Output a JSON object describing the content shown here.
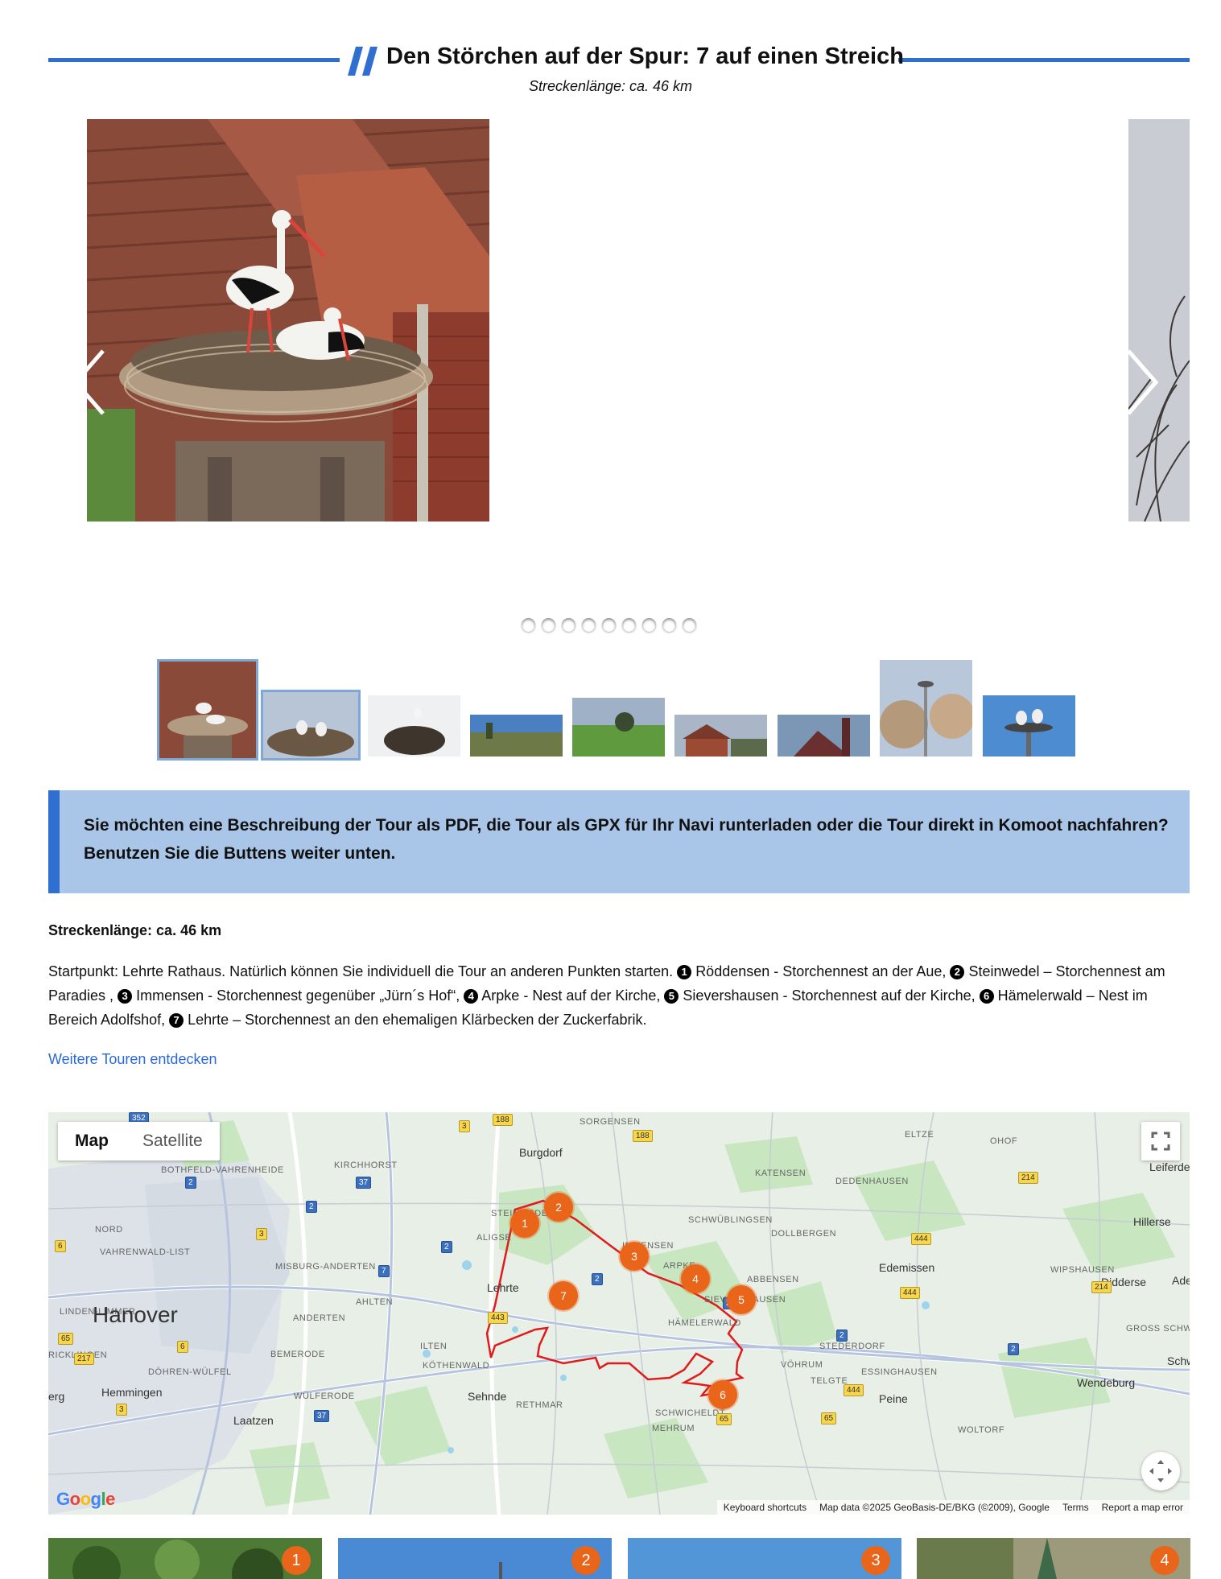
{
  "header": {
    "title": "Den Störchen auf der Spur: 7 auf einen Streich",
    "subtitle": "Streckenlänge: ca. 46 km",
    "accent_color": "#2f6fd0"
  },
  "carousel": {
    "prev_icon": "chevron-left-icon",
    "next_icon": "chevron-right-icon",
    "dot_count": 9,
    "active_index": 0
  },
  "thumbnails": {
    "count": 9,
    "selected_index": 0
  },
  "info_box": {
    "text": "Sie möchten eine Beschreibung der Tour als PDF, die Tour als GPX für Ihr Navi runterladen oder die Tour direkt in Komoot nachfahren? Benutzen Sie die Buttens weiter unten.",
    "background": "#a9c6e8"
  },
  "route": {
    "length": "Streckenlänge: ca. 46 km",
    "intro": "Startpunkt: Lehrte Rathaus. Natürlich können Sie individuell die Tour an anderen Punkten starten.",
    "stops": [
      {
        "n": "1",
        "text": "Röddensen - Storchennest an der Aue,"
      },
      {
        "n": "2",
        "text": "Steinwedel – Storchennest am Paradies ,"
      },
      {
        "n": "3",
        "text": "Immensen - Storchennest gegenüber „Jürn´s Hof“,"
      },
      {
        "n": "4",
        "text": "Arpke - Nest auf der Kirche,"
      },
      {
        "n": "5",
        "text": "Sievershausen - Storchennest auf der Kirche,"
      },
      {
        "n": "6",
        "text": "Hämelerwald – Nest im Bereich Adolfshof,"
      },
      {
        "n": "7",
        "text": "Lehrte – Storchennest an den ehemaligen Klärbecken der Zuckerfabrik."
      }
    ],
    "more_link": "Weitere Touren entdecken"
  },
  "map": {
    "tab_map": "Map",
    "tab_satellite": "Satellite",
    "active_tab": "Map",
    "fullscreen_icon": "fullscreen-icon",
    "camera_icon": "camera-control-icon",
    "logo": "Google",
    "footer": {
      "shortcuts": "Keyboard shortcuts",
      "data": "Map data ©2025 GeoBasis-DE/BKG (©2009), Google",
      "terms": "Terms",
      "report": "Report a map error"
    },
    "big_label": "Hanover",
    "labels": [
      "SORGENSEN",
      "Burgdorf",
      "ELTZE",
      "OHOF",
      "Leiferde",
      "BOTHFELD-VAHRENHEIDE",
      "KIRCHHORST",
      "KATENSEN",
      "DEDENHAUSEN",
      "STEINWEDEL",
      "SCHWÜBLINGSEN",
      "Hillerse",
      "NORD",
      "ALIGSE",
      "DOLLBERGEN",
      "VAHRENWALD-LIST",
      "IMMENSEN",
      "Edemissen",
      "MISBURG-ANDERTEN",
      "WIPSHAUSEN",
      "ABBENSEN",
      "Didderse",
      "Lehrte",
      "AHLTEN",
      "SIEVERSHAUSEN",
      "LINDEN-LIMMER",
      "ANDERTEN",
      "HÄMELERWALD",
      "GROSS SCHW",
      "ILTEN",
      "STEDERDORF",
      "RICKLINGEN",
      "BEMERODE",
      "DÖHREN-WÜLFEL",
      "KÖTHENWALD",
      "VÖHRUM",
      "ESSINGHAUSEN",
      "TELGTE",
      "Wendeburg",
      "Hemmingen",
      "WÜLFERODE",
      "Sehnde",
      "RETHMAR",
      "Peine",
      "SCHWICHELDT",
      "Laatzen",
      "MEHRUM",
      "WOLTORF",
      "ARPKE",
      "Schw",
      "Ade",
      "erg"
    ],
    "road_numbers": [
      "352",
      "3",
      "188",
      "188",
      "2",
      "37",
      "2",
      "214",
      "3",
      "2",
      "6",
      "444",
      "7",
      "2",
      "2",
      "214",
      "444",
      "65",
      "443",
      "6",
      "217",
      "2",
      "2",
      "444",
      "3",
      "37",
      "65",
      "65"
    ],
    "markers": [
      "1",
      "2",
      "3",
      "4",
      "5",
      "6",
      "7"
    ],
    "route_color": "#e01b1b",
    "marker_color": "#e8651a"
  },
  "cards": [
    {
      "badge": "1"
    },
    {
      "badge": "2"
    },
    {
      "badge": "3"
    },
    {
      "badge": "4"
    }
  ]
}
